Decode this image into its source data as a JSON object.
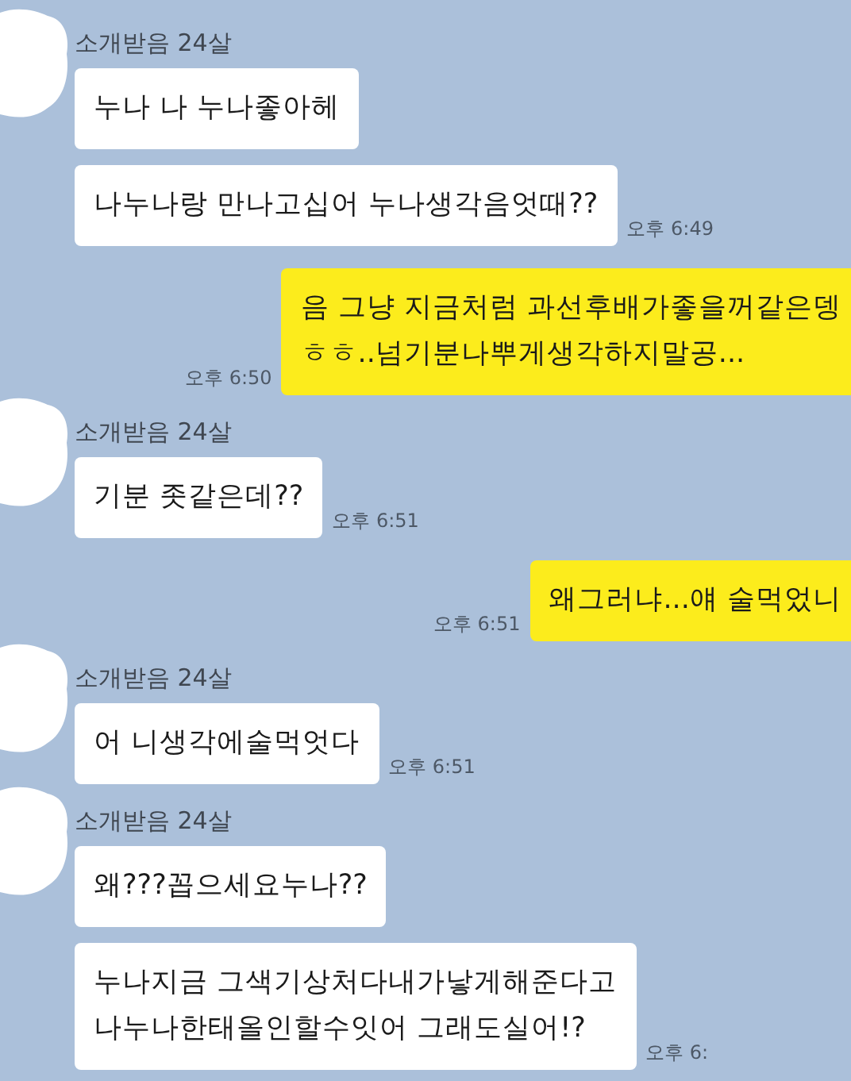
{
  "chat": [
    {
      "kind": "received",
      "sender": "소개받음 24살",
      "messages": [
        {
          "text": "누나 나 누나좋아헤"
        },
        {
          "text": "나누나랑 만나고십어 누나생각음엇때??",
          "time": "오후 6:49"
        }
      ]
    },
    {
      "kind": "sent",
      "messages": [
        {
          "text": "음 그냥 지금처럼 과선후배가좋을꺼같은뎅\nㅎㅎ..넘기분나뿌게생각하지말공...",
          "time": "오후 6:50"
        }
      ]
    },
    {
      "kind": "received",
      "sender": "소개받음 24살",
      "messages": [
        {
          "text": "기분 좃같은데??",
          "time": "오후 6:51"
        }
      ]
    },
    {
      "kind": "sent",
      "messages": [
        {
          "text": "왜그러냐...얘 술먹었니",
          "time": "오후 6:51"
        }
      ]
    },
    {
      "kind": "received",
      "sender": "소개받음 24살",
      "messages": [
        {
          "text": "어 니생각에술먹엇다",
          "time": "오후 6:51"
        }
      ]
    },
    {
      "kind": "received",
      "sender": "소개받음 24살",
      "messages": [
        {
          "text": "왜???꼽으세요누나??"
        },
        {
          "text": "누나지금 그색기상처다내가낳게해준다고\n나누나한태올인할수잇어 그래도실어!?",
          "time": "오후 6:"
        }
      ]
    }
  ]
}
